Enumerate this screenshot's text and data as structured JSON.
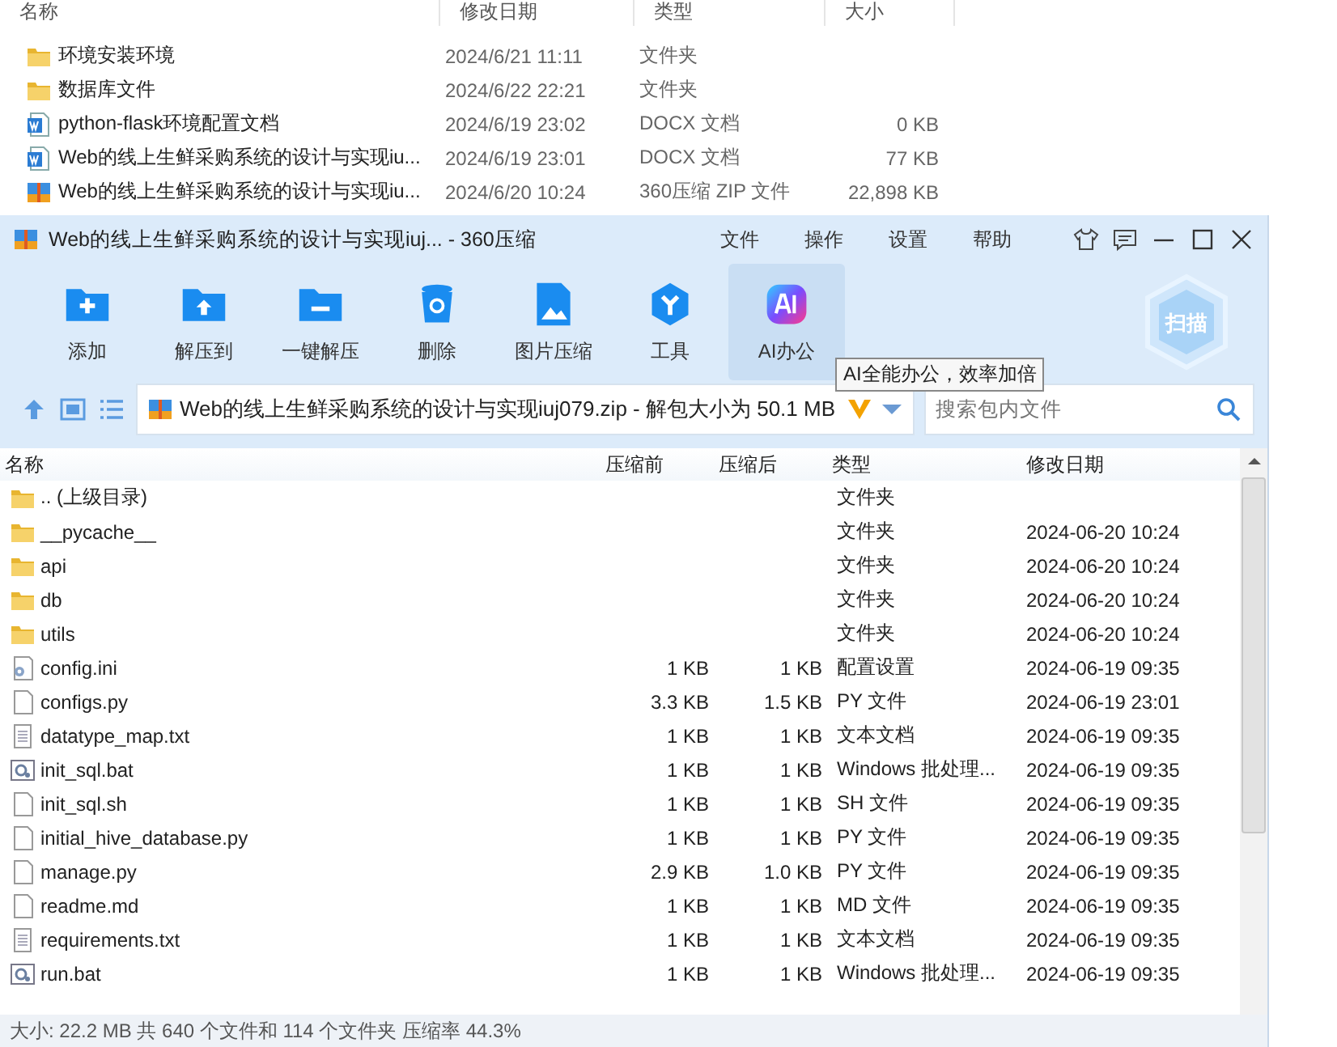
{
  "explorer": {
    "columns": [
      "名称",
      "修改日期",
      "类型",
      "大小"
    ],
    "rows": [
      {
        "name": "环境安装环境",
        "date": "2024/6/21 11:11",
        "type": "文件夹",
        "size": "",
        "kind": "folder"
      },
      {
        "name": "数据库文件",
        "date": "2024/6/22 22:21",
        "type": "文件夹",
        "size": "",
        "kind": "folder"
      },
      {
        "name": "python-flask环境配置文档",
        "date": "2024/6/19 23:02",
        "type": "DOCX 文档",
        "size": "0 KB",
        "kind": "docx"
      },
      {
        "name": "Web的线上生鲜采购系统的设计与实现iu...",
        "date": "2024/6/19 23:01",
        "type": "DOCX 文档",
        "size": "77 KB",
        "kind": "docx"
      },
      {
        "name": "Web的线上生鲜采购系统的设计与实现iu...",
        "date": "2024/6/20 10:24",
        "type": "360压缩 ZIP 文件",
        "size": "22,898 KB",
        "kind": "zip"
      }
    ]
  },
  "window": {
    "title": "Web的线上生鲜采购系统的设计与实现iuj... - 360压缩",
    "menu": [
      "文件",
      "操作",
      "设置",
      "帮助"
    ],
    "tools": [
      {
        "label": "添加",
        "kind": "add",
        "hovered": false
      },
      {
        "label": "解压到",
        "kind": "extract",
        "hovered": false
      },
      {
        "label": "一键解压",
        "kind": "oneclick",
        "hovered": false
      },
      {
        "label": "删除",
        "kind": "delete",
        "hovered": false
      },
      {
        "label": "图片压缩",
        "kind": "image",
        "hovered": false
      },
      {
        "label": "工具",
        "kind": "tools",
        "hovered": false
      },
      {
        "label": "AI办公",
        "kind": "ai",
        "hovered": true
      }
    ],
    "tooltip": "AI全能办公，效率加倍",
    "scan": "扫描",
    "address": "Web的线上生鲜采购系统的设计与实现iuj079.zip - 解包大小为 50.1 MB",
    "search": {
      "placeholder": "搜索包内文件"
    },
    "list": {
      "columns": [
        "名称",
        "压缩前",
        "压缩后",
        "类型",
        "修改日期"
      ],
      "rows": [
        {
          "name": ".. (上级目录)",
          "before": "",
          "after": "",
          "type": "文件夹",
          "date": "",
          "kind": "folder"
        },
        {
          "name": "__pycache__",
          "before": "",
          "after": "",
          "type": "文件夹",
          "date": "2024-06-20 10:24",
          "kind": "folder"
        },
        {
          "name": "api",
          "before": "",
          "after": "",
          "type": "文件夹",
          "date": "2024-06-20 10:24",
          "kind": "folder"
        },
        {
          "name": "db",
          "before": "",
          "after": "",
          "type": "文件夹",
          "date": "2024-06-20 10:24",
          "kind": "folder"
        },
        {
          "name": "utils",
          "before": "",
          "after": "",
          "type": "文件夹",
          "date": "2024-06-20 10:24",
          "kind": "folder"
        },
        {
          "name": "config.ini",
          "before": "1 KB",
          "after": "1 KB",
          "type": "配置设置",
          "date": "2024-06-19 09:35",
          "kind": "config"
        },
        {
          "name": "configs.py",
          "before": "3.3 KB",
          "after": "1.5 KB",
          "type": "PY 文件",
          "date": "2024-06-19 23:01",
          "kind": "file"
        },
        {
          "name": "datatype_map.txt",
          "before": "1 KB",
          "after": "1 KB",
          "type": "文本文档",
          "date": "2024-06-19 09:35",
          "kind": "text"
        },
        {
          "name": "init_sql.bat",
          "before": "1 KB",
          "after": "1 KB",
          "type": "Windows 批处理...",
          "date": "2024-06-19 09:35",
          "kind": "batch"
        },
        {
          "name": "init_sql.sh",
          "before": "1 KB",
          "after": "1 KB",
          "type": "SH 文件",
          "date": "2024-06-19 09:35",
          "kind": "file"
        },
        {
          "name": "initial_hive_database.py",
          "before": "1 KB",
          "after": "1 KB",
          "type": "PY 文件",
          "date": "2024-06-19 09:35",
          "kind": "file"
        },
        {
          "name": "manage.py",
          "before": "2.9 KB",
          "after": "1.0 KB",
          "type": "PY 文件",
          "date": "2024-06-19 09:35",
          "kind": "file"
        },
        {
          "name": "readme.md",
          "before": "1 KB",
          "after": "1 KB",
          "type": "MD 文件",
          "date": "2024-06-19 09:35",
          "kind": "file"
        },
        {
          "name": "requirements.txt",
          "before": "1 KB",
          "after": "1 KB",
          "type": "文本文档",
          "date": "2024-06-19 09:35",
          "kind": "text"
        },
        {
          "name": "run.bat",
          "before": "1 KB",
          "after": "1 KB",
          "type": "Windows 批处理...",
          "date": "2024-06-19 09:35",
          "kind": "batch"
        }
      ]
    },
    "status": "大小: 22.2 MB 共 640 个文件和 114 个文件夹 压缩率 44.3%"
  }
}
